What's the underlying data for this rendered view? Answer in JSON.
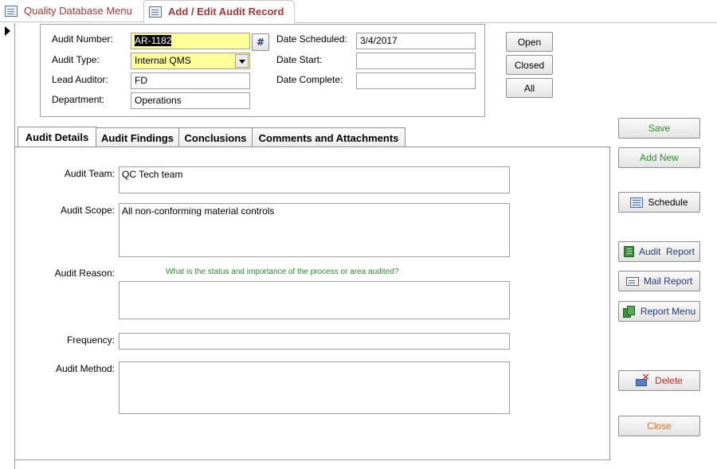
{
  "doc_tabs": [
    {
      "label": "Quality Database Menu",
      "active": false
    },
    {
      "label": "Add / Edit Audit Record",
      "active": true
    }
  ],
  "header": {
    "audit_number_label": "Audit Number:",
    "audit_number_value": "AR-1182",
    "audit_type_label": "Audit Type:",
    "audit_type_value": "Internal QMS",
    "lead_auditor_label": "Lead Auditor:",
    "lead_auditor_value": "FD",
    "department_label": "Department:",
    "department_value": "Operations",
    "date_scheduled_label": "Date Scheduled:",
    "date_scheduled_value": "3/4/2017",
    "date_start_label": "Date Start:",
    "date_start_value": "",
    "date_complete_label": "Date Complete:",
    "date_complete_value": "",
    "hash_button": "#"
  },
  "filters": {
    "open": "Open",
    "closed": "Closed",
    "all": "All"
  },
  "tabs": [
    {
      "label": "Audit Details",
      "active": true
    },
    {
      "label": "Audit Findings",
      "active": false
    },
    {
      "label": "Conclusions",
      "active": false
    },
    {
      "label": "Comments and Attachments",
      "active": false
    }
  ],
  "details": {
    "audit_team_label": "Audit Team:",
    "audit_team_value": "QC Tech team",
    "audit_scope_label": "Audit Scope:",
    "audit_scope_value": "All non-conforming material controls",
    "audit_reason_label": "Audit Reason:",
    "audit_reason_hint": "What is the status and importance of the process or area audited?",
    "audit_reason_value": "",
    "frequency_label": "Frequency:",
    "frequency_value": "",
    "audit_method_label": "Audit Method:",
    "audit_method_value": ""
  },
  "actions": {
    "save": "Save",
    "add_new": "Add New",
    "schedule": "Schedule",
    "audit_report": "Audit  Report",
    "mail_report": "Mail Report",
    "report_menu": "Report Menu",
    "delete": "Delete",
    "close": "Close"
  }
}
